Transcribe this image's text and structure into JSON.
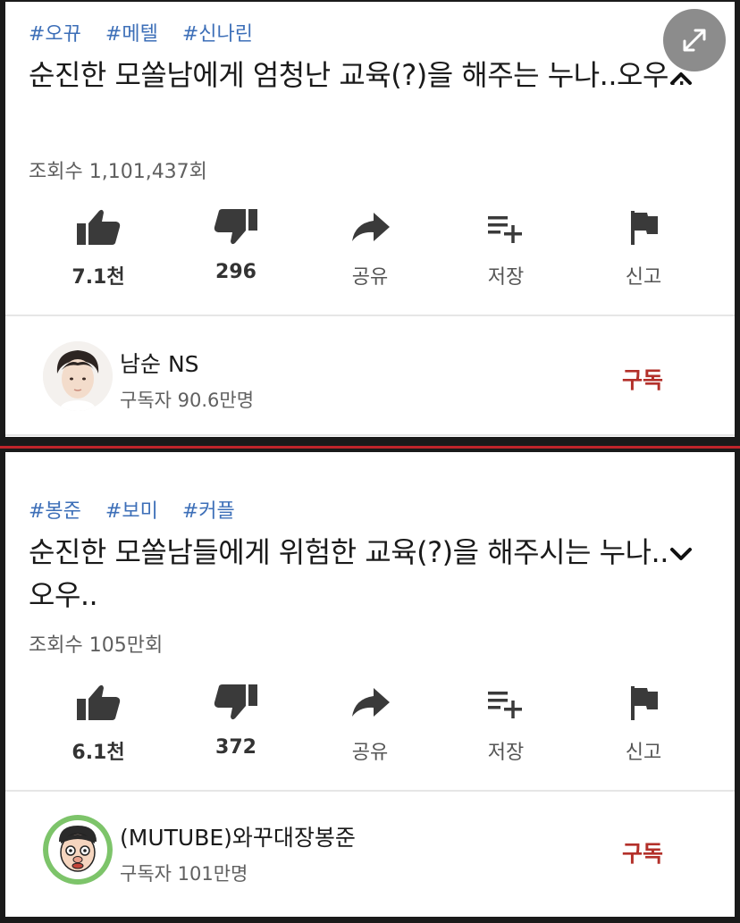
{
  "post1": {
    "tags": [
      "#오뀨",
      "#메텔",
      "#신나린"
    ],
    "title": "순진한 모쏠남에게 엄청난 교육(?)을 해주는 누나..오우..",
    "views": "조회수 1,101,437회",
    "actions": {
      "like": "7.1천",
      "dislike": "296",
      "share": "공유",
      "save": "저장",
      "report": "신고"
    },
    "channel": {
      "name": "남순 NS",
      "subscribers": "구독자 90.6만명",
      "subscribe_label": "구독"
    }
  },
  "post2": {
    "tags": [
      "#봉준",
      "#보미",
      "#커플"
    ],
    "title": "순진한 모쏠남들에게 위험한 교육(?)을 해주시는 누나.. 오우..",
    "views": "조회수 105만회",
    "actions": {
      "like": "6.1천",
      "dislike": "372",
      "share": "공유",
      "save": "저장",
      "report": "신고"
    },
    "channel": {
      "name": "(MUTUBE)와꾸대장봉준",
      "subscribers": "구독자 101만명",
      "subscribe_label": "구독"
    }
  },
  "icons": [
    "thumb-up-icon",
    "thumb-down-icon",
    "share-icon",
    "playlist-add-icon",
    "flag-icon",
    "chevron-up-icon",
    "chevron-down-icon",
    "expand-icon"
  ],
  "colors": {
    "tag": "#3d6fb8",
    "subscribe": "#b3302a",
    "divider": "#c0242a"
  }
}
